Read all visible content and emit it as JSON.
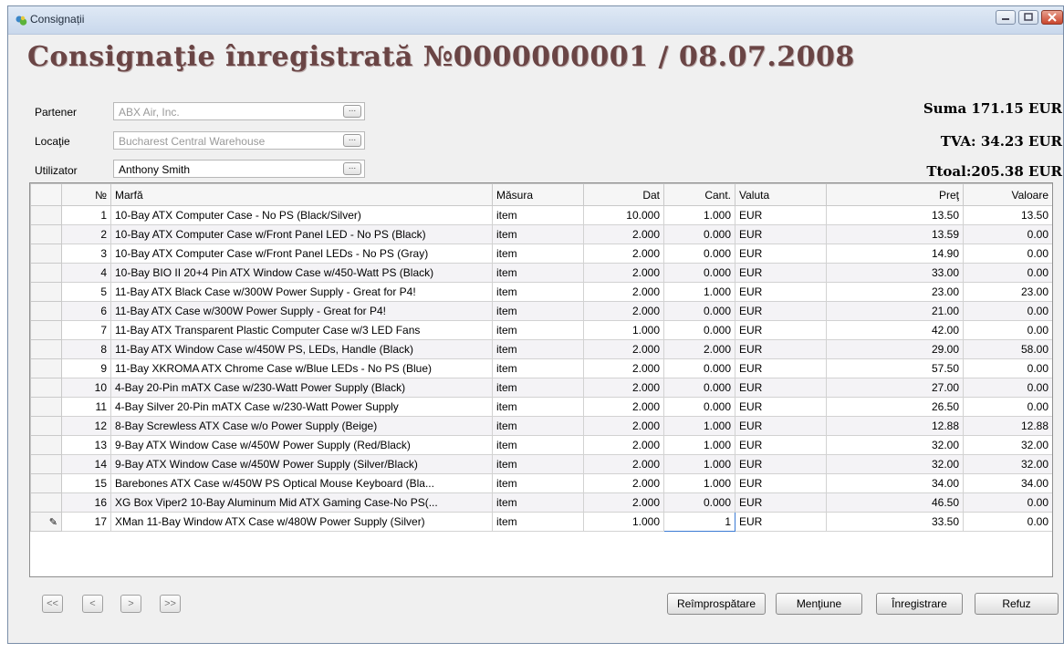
{
  "window": {
    "title": "Consignații"
  },
  "heading": "Consignaţie înregistrată №0000000001 / 08.07.2008",
  "fields": {
    "partener": {
      "label": "Partener",
      "value": "ABX Air, Inc.",
      "button": "..."
    },
    "locatie": {
      "label": "Locaţie",
      "value": "Bucharest Central Warehouse",
      "button": "..."
    },
    "utilizator": {
      "label": "Utilizator",
      "value": "Anthony Smith",
      "button": "..."
    }
  },
  "totals": {
    "suma": "Suma 171.15 EUR",
    "tva": "TVA: 34.23 EUR",
    "total": "Ttoal:205.38 EUR"
  },
  "grid": {
    "columns": [
      "№",
      "Marfă",
      "Măsura",
      "Dat",
      "Cant.",
      "Valuta",
      "Preţ",
      "Valoare"
    ],
    "rows": [
      [
        "1",
        "10-Bay ATX Computer Case - No PS (Black/Silver)",
        "item",
        "10.000",
        "1.000",
        "EUR",
        "13.50",
        "13.50"
      ],
      [
        "2",
        "10-Bay ATX Computer Case w/Front Panel LED - No PS (Black)",
        "item",
        "2.000",
        "0.000",
        "EUR",
        "13.59",
        "0.00"
      ],
      [
        "3",
        "10-Bay ATX Computer Case w/Front Panel LEDs - No PS (Gray)",
        "item",
        "2.000",
        "0.000",
        "EUR",
        "14.90",
        "0.00"
      ],
      [
        "4",
        "10-Bay BIO II 20+4 Pin ATX Window Case w/450-Watt PS (Black)",
        "item",
        "2.000",
        "0.000",
        "EUR",
        "33.00",
        "0.00"
      ],
      [
        "5",
        "11-Bay ATX Black Case w/300W Power Supply - Great for P4!",
        "item",
        "2.000",
        "1.000",
        "EUR",
        "23.00",
        "23.00"
      ],
      [
        "6",
        "11-Bay ATX Case w/300W Power Supply - Great for P4!",
        "item",
        "2.000",
        "0.000",
        "EUR",
        "21.00",
        "0.00"
      ],
      [
        "7",
        "11-Bay ATX Transparent Plastic Computer Case w/3 LED Fans",
        "item",
        "1.000",
        "0.000",
        "EUR",
        "42.00",
        "0.00"
      ],
      [
        "8",
        "11-Bay ATX Window Case w/450W PS, LEDs,  Handle (Black)",
        "item",
        "2.000",
        "2.000",
        "EUR",
        "29.00",
        "58.00"
      ],
      [
        "9",
        "11-Bay XKROMA ATX Chrome Case w/Blue LEDs - No PS (Blue)",
        "item",
        "2.000",
        "0.000",
        "EUR",
        "57.50",
        "0.00"
      ],
      [
        "10",
        "4-Bay 20-Pin mATX Case w/230-Watt Power Supply (Black)",
        "item",
        "2.000",
        "0.000",
        "EUR",
        "27.00",
        "0.00"
      ],
      [
        "11",
        "4-Bay Silver 20-Pin mATX Case w/230-Watt Power Supply",
        "item",
        "2.000",
        "0.000",
        "EUR",
        "26.50",
        "0.00"
      ],
      [
        "12",
        "8-Bay Screwless ATX Case w/o Power Supply (Beige)",
        "item",
        "2.000",
        "1.000",
        "EUR",
        "12.88",
        "12.88"
      ],
      [
        "13",
        "9-Bay ATX Window Case w/450W Power Supply (Red/Black)",
        "item",
        "2.000",
        "1.000",
        "EUR",
        "32.00",
        "32.00"
      ],
      [
        "14",
        "9-Bay ATX Window Case w/450W Power Supply (Silver/Black)",
        "item",
        "2.000",
        "1.000",
        "EUR",
        "32.00",
        "32.00"
      ],
      [
        "15",
        "Barebones ATX Case w/450W PS Optical Mouse Keyboard (Bla...",
        "item",
        "2.000",
        "1.000",
        "EUR",
        "34.00",
        "34.00"
      ],
      [
        "16",
        "XG Box Viper2 10-Bay Aluminum Mid ATX Gaming Case-No PS(...",
        "item",
        "2.000",
        "0.000",
        "EUR",
        "46.50",
        "0.00"
      ],
      [
        "17",
        "XMan 11-Bay Window ATX Case w/480W Power Supply (Silver)",
        "item",
        "1.000",
        "1",
        "EUR",
        "33.50",
        "0.00"
      ]
    ]
  },
  "nav": {
    "first": "<<",
    "prev": "<",
    "next": ">",
    "last": ">>"
  },
  "actions": {
    "refresh": "Reîmprospătare",
    "mention": "Menţiune",
    "register": "Înregistrare",
    "refuse": "Refuz"
  }
}
